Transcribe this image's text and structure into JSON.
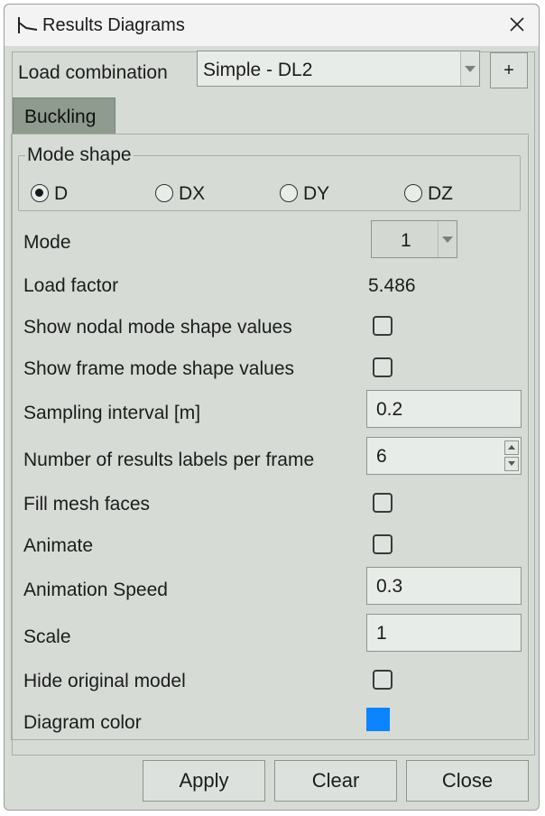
{
  "window": {
    "title": "Results Diagrams",
    "icon": "diagram-icon",
    "close_icon": "close-icon"
  },
  "load_combination": {
    "label": "Load combination",
    "value": "Simple - DL2",
    "add_label": "+"
  },
  "tabs": [
    {
      "label": "Buckling",
      "selected": true
    }
  ],
  "mode_shape": {
    "legend": "Mode shape",
    "options": [
      {
        "label": "D",
        "selected": true
      },
      {
        "label": "DX",
        "selected": false
      },
      {
        "label": "DY",
        "selected": false
      },
      {
        "label": "DZ",
        "selected": false
      }
    ]
  },
  "mode": {
    "label": "Mode",
    "value": "1"
  },
  "load_factor": {
    "label": "Load factor",
    "value": "5.486"
  },
  "show_nodal": {
    "label": "Show nodal mode shape values",
    "checked": false
  },
  "show_frame": {
    "label": "Show frame mode shape values",
    "checked": false
  },
  "sampling_interval": {
    "label": "Sampling interval [m]",
    "value": "0.2"
  },
  "num_labels": {
    "label": "Number of results labels per frame",
    "value": "6"
  },
  "fill_mesh": {
    "label": "Fill mesh faces",
    "checked": false
  },
  "animate": {
    "label": "Animate",
    "checked": false
  },
  "animation_speed": {
    "label": "Animation Speed",
    "value": "0.3"
  },
  "scale": {
    "label": "Scale",
    "value": "1"
  },
  "hide_original": {
    "label": "Hide original model",
    "checked": false
  },
  "diagram_color": {
    "label": "Diagram color",
    "color": "#0a84ff"
  },
  "buttons": {
    "apply": "Apply",
    "clear": "Clear",
    "close": "Close"
  }
}
